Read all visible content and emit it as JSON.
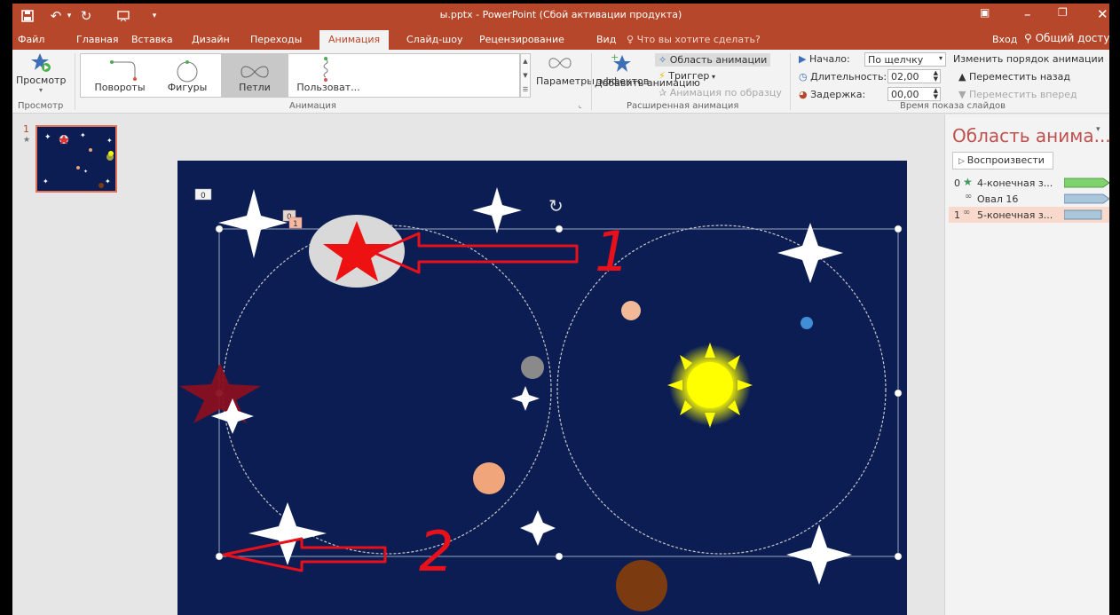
{
  "titlebar": {
    "title": "ы.pptx - PowerPoint (Сбой активации продукта)",
    "save_icon": "save-icon",
    "undo_icon": "undo-icon",
    "redo_icon": "redo-icon",
    "present_icon": "present-icon",
    "customize_icon": "customize-icon",
    "ribbon_display_icon": "ribbon-display-icon",
    "minimize_icon": "minimize-icon",
    "restore_icon": "restore-icon",
    "close_icon": "close-icon"
  },
  "tabs": {
    "items": [
      "Файл",
      "Главная",
      "Вставка",
      "Дизайн",
      "Переходы",
      "Анимация",
      "Слайд-шоу",
      "Рецензирование",
      "Вид"
    ],
    "active": "Анимация",
    "tell_me": "Что вы хотите сделать?",
    "sign_in": "Вход",
    "share": "Общий доступ"
  },
  "ribbon": {
    "preview": {
      "button": "Просмотр",
      "group": "Просмотр"
    },
    "animation": {
      "group": "Анимация",
      "gallery": [
        {
          "label": "Повороты"
        },
        {
          "label": "Фигуры"
        },
        {
          "label": "Петли",
          "selected": true
        },
        {
          "label": "Пользоват..."
        }
      ],
      "effect_options": "Параметры эффектов"
    },
    "advanced": {
      "group": "Расширенная анимация",
      "add_animation": "Добавить анимацию",
      "animation_pane": "Область анимации",
      "trigger": "Триггер",
      "animation_painter": "Анимация по образцу"
    },
    "timing": {
      "group": "Время показа слайдов",
      "start_label": "Начало:",
      "start_value": "По щелчку",
      "duration_label": "Длительность:",
      "duration_value": "02,00",
      "delay_label": "Задержка:",
      "delay_value": "00,00",
      "reorder_title": "Изменить порядок анимации",
      "move_earlier": "Переместить назад",
      "move_later": "Переместить вперед"
    }
  },
  "thumbnails": {
    "slide_number": "1"
  },
  "slide": {
    "tag_zero": "0",
    "tag_one": "1",
    "overlap_tag": "0",
    "annotation_1": "1",
    "annotation_2": "2"
  },
  "animation_pane": {
    "title": "Область анима...",
    "play": "Воспроизвести",
    "items": [
      {
        "num": "0",
        "name": "4-конечная з...",
        "color": "#7fd36e"
      },
      {
        "num": "",
        "name": "Овал 16",
        "color": "#a9c6db"
      },
      {
        "num": "1",
        "name": "5-конечная з...",
        "color": "#a9c6db",
        "selected": true
      }
    ]
  },
  "colors": {
    "accent": "#b7472a",
    "slide_bg": "#0b1d52",
    "annotation_red": "#e8101a"
  }
}
